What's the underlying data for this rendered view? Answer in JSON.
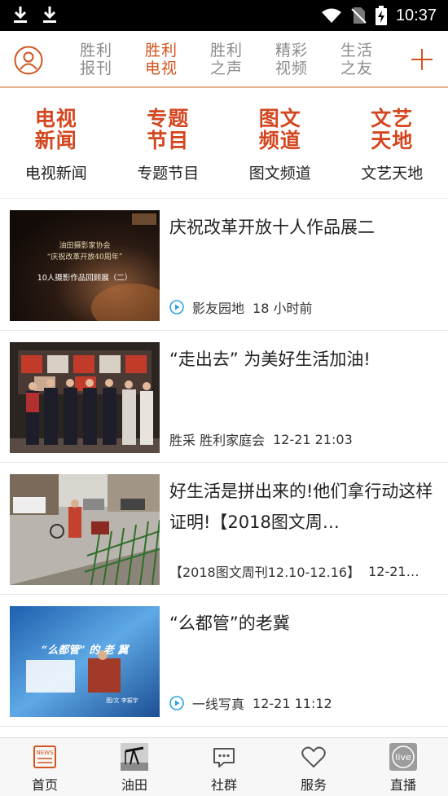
{
  "status_bar": {
    "time": "10:37"
  },
  "top_tabs": [
    {
      "label": "胜利\n报刊",
      "active": false
    },
    {
      "label": "胜利\n电视",
      "active": true
    },
    {
      "label": "胜利\n之声",
      "active": false
    },
    {
      "label": "精彩\n视频",
      "active": false
    },
    {
      "label": "生活\n之友",
      "active": false
    }
  ],
  "quick_links": [
    {
      "logo": "电视\n新闻",
      "label": "电视新闻"
    },
    {
      "logo": "专题\n节目",
      "label": "专题节目"
    },
    {
      "logo": "图文\n频道",
      "label": "图文频道"
    },
    {
      "logo": "文艺\n天地",
      "label": "文艺天地"
    }
  ],
  "news": [
    {
      "title": "庆祝改革开放十人作品展二",
      "has_video": true,
      "source": "影友园地",
      "time": "18 小时前",
      "thumb_lines": [
        "油田摄影家协会",
        "“庆祝改革开放40周年”",
        "10人摄影作品回顾展（二）"
      ]
    },
    {
      "title": "“走出去” 为美好生活加油!",
      "has_video": false,
      "source": "胜采 胜利家庭会",
      "time": "12-21 21:03"
    },
    {
      "title": "好生活是拼出来的!他们拿行动这样证明!【2018图文周…",
      "has_video": false,
      "source": "【2018图文周刊12.10-12.16】",
      "time": "12-21…"
    },
    {
      "title": "“么都管”的老冀",
      "has_video": true,
      "source": "一线写真",
      "time": "12-21 11:12",
      "thumb_lines": [
        "“么都管” 的 老 冀",
        "图/文 李振宇"
      ]
    }
  ],
  "bottom_nav": [
    {
      "label": "首页",
      "icon": "news-icon"
    },
    {
      "label": "油田",
      "icon": "oil-pump-icon"
    },
    {
      "label": "社群",
      "icon": "chat-icon"
    },
    {
      "label": "服务",
      "icon": "heart-icon"
    },
    {
      "label": "直播",
      "icon": "live-icon"
    }
  ]
}
